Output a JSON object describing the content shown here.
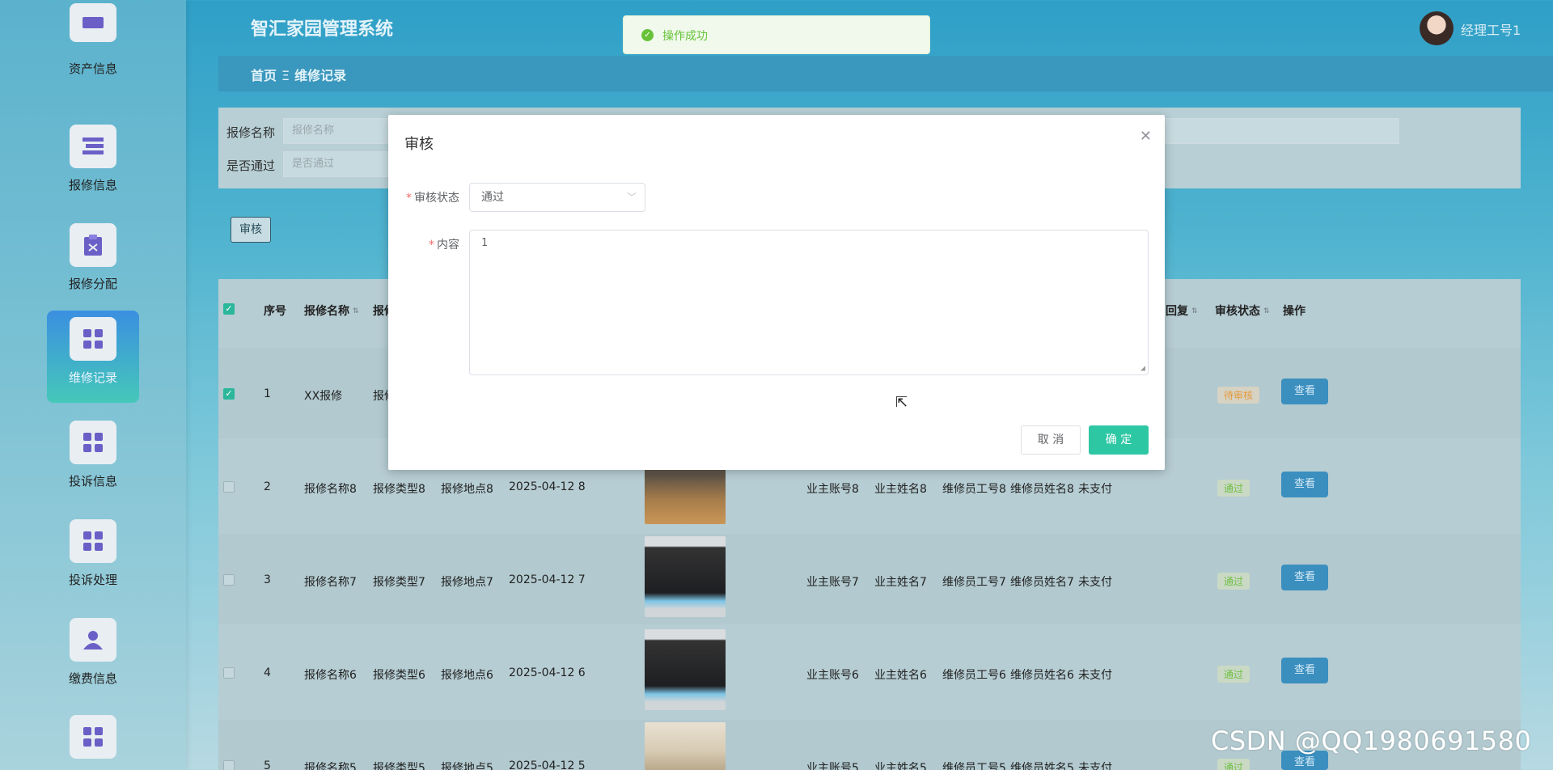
{
  "app": {
    "title": "智汇家园管理系统",
    "user_name": "经理工号1"
  },
  "breadcrumb": {
    "home": "首页",
    "separator": "Ξ",
    "current": "维修记录"
  },
  "sidebar": {
    "items": [
      {
        "label": "资产信息",
        "icon": "asset-icon",
        "active": false
      },
      {
        "label": "报修信息",
        "icon": "repair-info-icon",
        "active": false
      },
      {
        "label": "报修分配",
        "icon": "clipboard-icon",
        "active": false
      },
      {
        "label": "维修记录",
        "icon": "grid-icon",
        "active": true
      },
      {
        "label": "投诉信息",
        "icon": "grid-icon",
        "active": false
      },
      {
        "label": "投诉处理",
        "icon": "grid-icon",
        "active": false
      },
      {
        "label": "缴费信息",
        "icon": "user-icon",
        "active": false
      },
      {
        "label": "",
        "icon": "grid-icon",
        "active": false
      }
    ]
  },
  "search": {
    "name_label": "报修名称",
    "name_placeholder": "报修名称",
    "pass_label": "是否通过",
    "pass_placeholder": "是否通过"
  },
  "toolbar": {
    "audit_label": "审核"
  },
  "table": {
    "columns": [
      "序号",
      "报修名称",
      "报修",
      "回复",
      "审核状态",
      "操作"
    ],
    "view_label": "查看",
    "rows": [
      {
        "index": "1",
        "name": "XX报修",
        "type": "报修",
        "place": "",
        "date": "",
        "owner_account": "",
        "owner_name": "",
        "worker_id": "",
        "worker_name": "",
        "pay": "",
        "status": "待审核",
        "status_kind": "pending",
        "image": ""
      },
      {
        "index": "2",
        "name": "报修名称8",
        "type": "报修类型8",
        "place": "报修地点8",
        "date": "2025-04-12 8",
        "owner_account": "业主账号8",
        "owner_name": "业主姓名8",
        "worker_id": "维修员工号8",
        "worker_name": "维修员姓名8",
        "pay": "未支付",
        "status": "通过",
        "status_kind": "pass",
        "image": "room"
      },
      {
        "index": "3",
        "name": "报修名称7",
        "type": "报修类型7",
        "place": "报修地点7",
        "date": "2025-04-12 7",
        "owner_account": "业主账号7",
        "owner_name": "业主姓名7",
        "worker_id": "维修员工号7",
        "worker_name": "维修员姓名7",
        "pay": "未支付",
        "status": "通过",
        "status_kind": "pass",
        "image": "ac"
      },
      {
        "index": "4",
        "name": "报修名称6",
        "type": "报修类型6",
        "place": "报修地点6",
        "date": "2025-04-12 6",
        "owner_account": "业主账号6",
        "owner_name": "业主姓名6",
        "worker_id": "维修员工号6",
        "worker_name": "维修员姓名6",
        "pay": "未支付",
        "status": "通过",
        "status_kind": "pass",
        "image": "ac"
      },
      {
        "index": "5",
        "name": "报修名称5",
        "type": "报修类型5",
        "place": "报修地点5",
        "date": "2025-04-12 5",
        "owner_account": "业主账号5",
        "owner_name": "业主姓名5",
        "worker_id": "维修员工号5",
        "worker_name": "维修员姓名5",
        "pay": "未支付",
        "status": "通过",
        "status_kind": "pass",
        "image": "plant"
      }
    ]
  },
  "modal": {
    "title": "审核",
    "status_label": "审核状态",
    "status_value": "通过",
    "content_label": "内容",
    "content_value": "1",
    "cancel_label": "取 消",
    "ok_label": "确 定"
  },
  "toast": {
    "text": "操作成功"
  },
  "watermark": "CSDN @QQ1980691580",
  "colors": {
    "primary": "#2ec7a4",
    "success": "#67c23a",
    "required": "#f56c6c",
    "view_button": "#3a8fbf"
  }
}
